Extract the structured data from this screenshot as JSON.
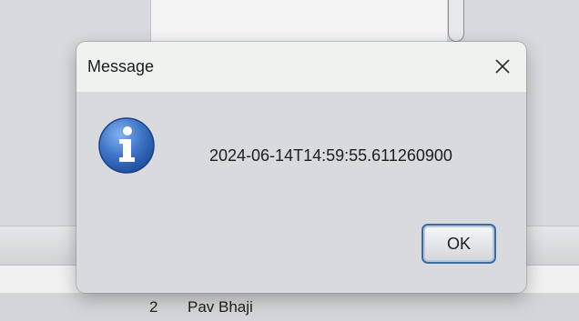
{
  "dialog": {
    "title": "Message",
    "message": "2024-06-14T14:59:55.611260900",
    "ok_label": "OK",
    "icon": "info-icon",
    "close_icon": "close-icon"
  },
  "background": {
    "row": {
      "number": "2",
      "name": "Pav Bhaji"
    }
  },
  "colors": {
    "dialog_body": "#d8dade",
    "titlebar": "#eef3f0",
    "info_icon_blue": "#2f62b6",
    "ok_border": "#3d6aa0"
  }
}
